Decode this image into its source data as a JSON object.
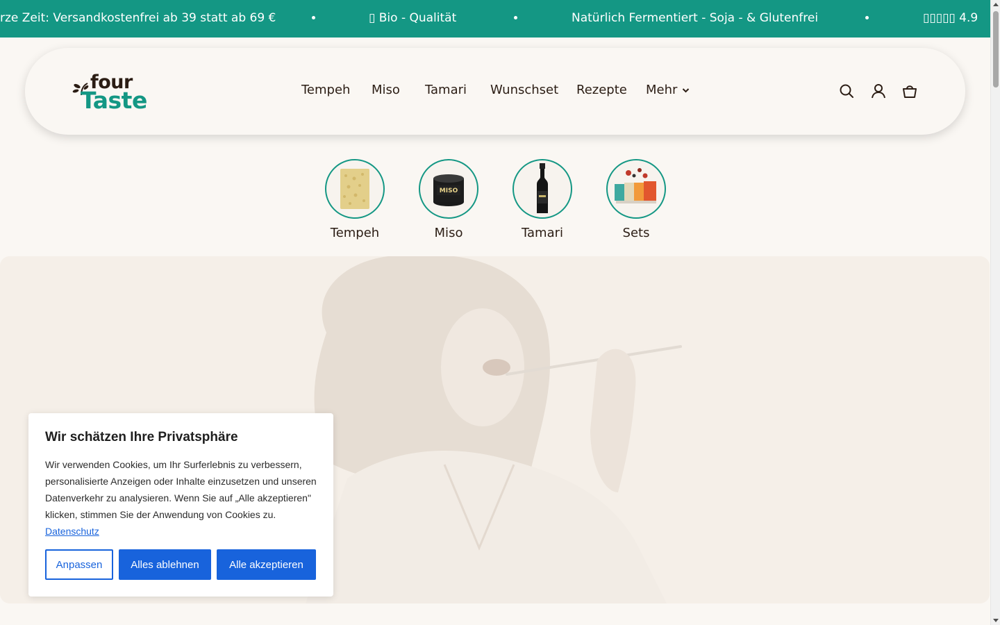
{
  "announcement": {
    "items": [
      "rze Zeit: Versandkostenfrei ab 39 statt ab 69 €",
      "▯ Bio - Qualität",
      "Natürlich Fermentiert - Soja - & Glutenfrei",
      "▯▯▯▯▯ 4.9"
    ],
    "background": "#149784"
  },
  "header": {
    "logo": {
      "top": "four",
      "bottom": "Taste"
    },
    "nav": [
      "Tempeh",
      "Miso",
      "Tamari",
      "Wunschset",
      "Rezepte",
      "Mehr"
    ],
    "icons": [
      "search-icon",
      "account-icon",
      "cart-icon"
    ]
  },
  "categories": [
    {
      "label": "Tempeh",
      "icon": "tempeh-product"
    },
    {
      "label": "Miso",
      "icon": "miso-jar"
    },
    {
      "label": "Tamari",
      "icon": "tamari-bottle"
    },
    {
      "label": "Sets",
      "icon": "product-set"
    }
  ],
  "cookie": {
    "title": "Wir schätzen Ihre Privatsphäre",
    "text": "Wir verwenden Cookies, um Ihr Surferlebnis zu verbessern, personalisierte Anzeigen oder Inhalte einzusetzen und unseren Datenverkehr zu analysieren. Wenn Sie auf „Alle akzeptieren\" klicken, stimmen Sie der Anwendung von Cookies zu.",
    "link": "Datenschutz",
    "buttons": {
      "customize": "Anpassen",
      "reject": "Alles ablehnen",
      "accept": "Alle akzeptieren"
    },
    "accent": "#1863dc"
  },
  "colors": {
    "brand": "#149784",
    "text": "#2b1d14",
    "background": "#faf7f3"
  }
}
